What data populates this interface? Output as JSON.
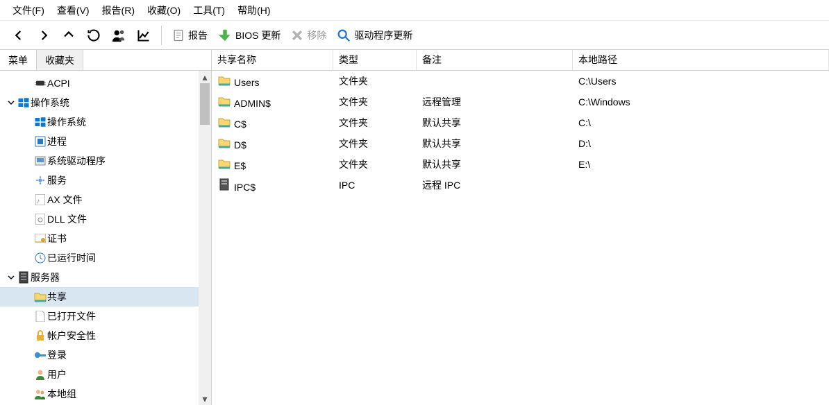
{
  "menubar": {
    "file": "文件(F)",
    "view": "查看(V)",
    "report": "报告(R)",
    "favorites": "收藏(O)",
    "tools": "工具(T)",
    "help": "帮助(H)"
  },
  "toolbar": {
    "report_label": "报告",
    "bios_label": "BIOS 更新",
    "remove_label": "移除",
    "driver_label": "驱动程序更新"
  },
  "sidebar_tabs": {
    "menu": "菜单",
    "favorites": "收藏夹"
  },
  "tree": {
    "acpi": "ACPI",
    "os_group": "操作系统",
    "os_item": "操作系统",
    "processes": "进程",
    "sysdrivers": "系统驱动程序",
    "services": "服务",
    "ax_files": "AX 文件",
    "dll_files": "DLL 文件",
    "certs": "证书",
    "uptime": "已运行时间",
    "server_group": "服务器",
    "shares": "共享",
    "opened_files": "已打开文件",
    "account_security": "帐户安全性",
    "logon": "登录",
    "users": "用户",
    "local_group": "本地组"
  },
  "table": {
    "headers": {
      "name": "共享名称",
      "type": "类型",
      "note": "备注",
      "path": "本地路径"
    },
    "rows": [
      {
        "icon": "folder",
        "name": "Users",
        "type": "文件夹",
        "note": "",
        "path": "C:\\Users"
      },
      {
        "icon": "folder",
        "name": "ADMIN$",
        "type": "文件夹",
        "note": "远程管理",
        "path": "C:\\Windows"
      },
      {
        "icon": "folder",
        "name": "C$",
        "type": "文件夹",
        "note": "默认共享",
        "path": "C:\\"
      },
      {
        "icon": "folder",
        "name": "D$",
        "type": "文件夹",
        "note": "默认共享",
        "path": "D:\\"
      },
      {
        "icon": "folder",
        "name": "E$",
        "type": "文件夹",
        "note": "默认共享",
        "path": "E:\\"
      },
      {
        "icon": "ipc",
        "name": "IPC$",
        "type": "IPC",
        "note": "远程 IPC",
        "path": ""
      }
    ]
  }
}
